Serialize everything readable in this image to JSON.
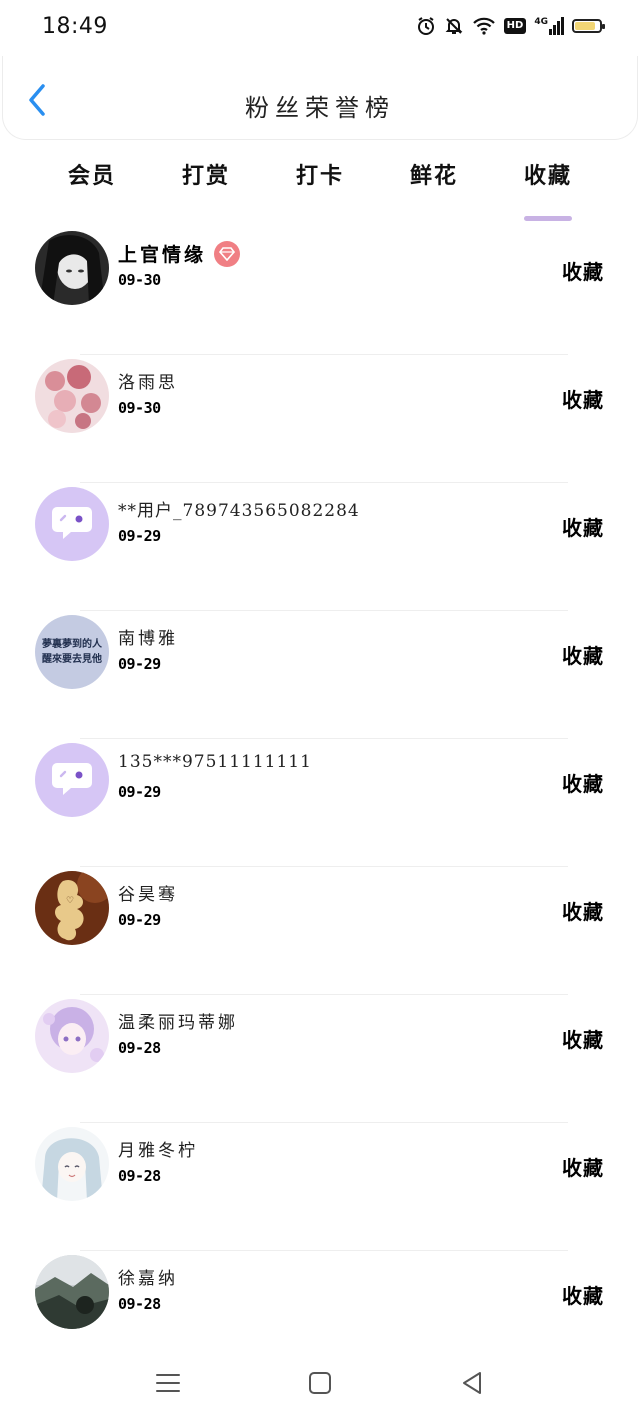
{
  "status_bar": {
    "time": "18:49",
    "icons": [
      "alarm-icon",
      "bell-muted-icon",
      "wifi-icon",
      "hd-icon",
      "signal-4g-icon",
      "battery-icon"
    ],
    "hd_label": "HD",
    "network_label": "4G",
    "battery_level": 0.85,
    "battery_color": "#f2d675"
  },
  "header": {
    "title": "粉丝荣誉榜",
    "back_icon": "chevron-left-icon",
    "accent_color": "#2a8ff0"
  },
  "tabs": {
    "items": [
      {
        "label": "会员"
      },
      {
        "label": "打赏"
      },
      {
        "label": "打卡"
      },
      {
        "label": "鲜花"
      },
      {
        "label": "收藏"
      }
    ],
    "active_index": 4,
    "underline_color": "#c8b2e4"
  },
  "fans": [
    {
      "name": "上官情缘",
      "date": "09-30",
      "action": "收藏",
      "vip": true,
      "avatar": "anime-girl-avatar"
    },
    {
      "name": "洛雨思",
      "date": "09-30",
      "action": "收藏",
      "vip": false,
      "avatar": "pink-flowers-avatar"
    },
    {
      "name": "**用户_789743565082284",
      "date": "09-29",
      "action": "收藏",
      "vip": false,
      "avatar": "default-chat-avatar"
    },
    {
      "name": "南博雅",
      "date": "09-29",
      "action": "收藏",
      "vip": false,
      "avatar": "quote-text-avatar",
      "avatar_text": [
        "夢裏夢到的人",
        "醒來要去見他"
      ]
    },
    {
      "name": "135***97511111111",
      "date": "09-29",
      "action": "收藏",
      "vip": false,
      "avatar": "default-chat-avatar"
    },
    {
      "name": "谷昊骞",
      "date": "09-29",
      "action": "收藏",
      "vip": false,
      "avatar": "love-cookie-avatar"
    },
    {
      "name": "温柔丽玛蒂娜",
      "date": "09-28",
      "action": "收藏",
      "vip": false,
      "avatar": "anime-purple-girl-avatar"
    },
    {
      "name": "月雅冬柠",
      "date": "09-28",
      "action": "收藏",
      "vip": false,
      "avatar": "anime-silver-girl-avatar"
    },
    {
      "name": "徐嘉纳",
      "date": "09-28",
      "action": "收藏",
      "vip": false,
      "avatar": "landscape-avatar"
    }
  ],
  "nav_bar": {
    "items": [
      "menu-icon",
      "home-icon",
      "back-triangle-icon"
    ]
  }
}
